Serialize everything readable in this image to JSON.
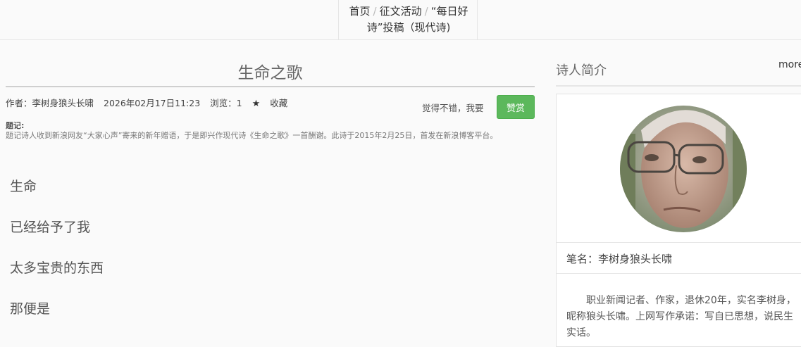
{
  "breadcrumb": {
    "home": "首页",
    "activity": "征文活动",
    "current": "“每日好诗”投稿（现代诗)",
    "separator": "/"
  },
  "article": {
    "title": "生命之歌",
    "author_label": "作者：李树身狼头长啸",
    "date": "2026年02月17日11:23",
    "views_label": "浏览：1",
    "favorite_label": "收藏",
    "reward_prompt": "觉得不错，我要",
    "reward_button": "赞赏",
    "note_label": "题记:",
    "note_text": "题记诗人收到新浪网友“大家心声”寄来的新年赠语，于是即兴作现代诗《生命之歌》一首酬谢。此诗于2015年2月25日，首发在新浪博客平台。",
    "poem_lines": [
      "生命",
      "已经给予了我",
      "太多宝贵的东西",
      "那便是"
    ]
  },
  "sidebar": {
    "title": "诗人简介",
    "more": "more",
    "pen_name": "笔名：李树身狼头长啸",
    "bio": "职业新闻记者、作家，退休20年，实名李树身，昵称狼头长啸。上网写作承诺：写自已思想，说民生实话。"
  },
  "colors": {
    "accent_green": "#5cb85c",
    "background": "#fafafa"
  }
}
